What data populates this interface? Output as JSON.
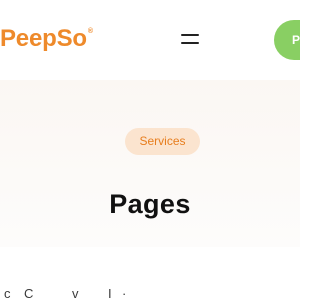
{
  "brand": {
    "name": "PeepSo",
    "registered_mark": "®"
  },
  "header": {
    "menu_icon": "menu-icon",
    "action_button_label": "P",
    "action_color": "#89cf63"
  },
  "hero": {
    "badge": "Services",
    "title": "Pages"
  },
  "bottom_text_fragments": [
    "c",
    "C",
    "v",
    "I",
    "·"
  ],
  "colors": {
    "brand_orange": "#ee8a2b",
    "badge_background": "#fbe4cf",
    "hero_background": "#fbf7f3",
    "title": "#111111"
  }
}
